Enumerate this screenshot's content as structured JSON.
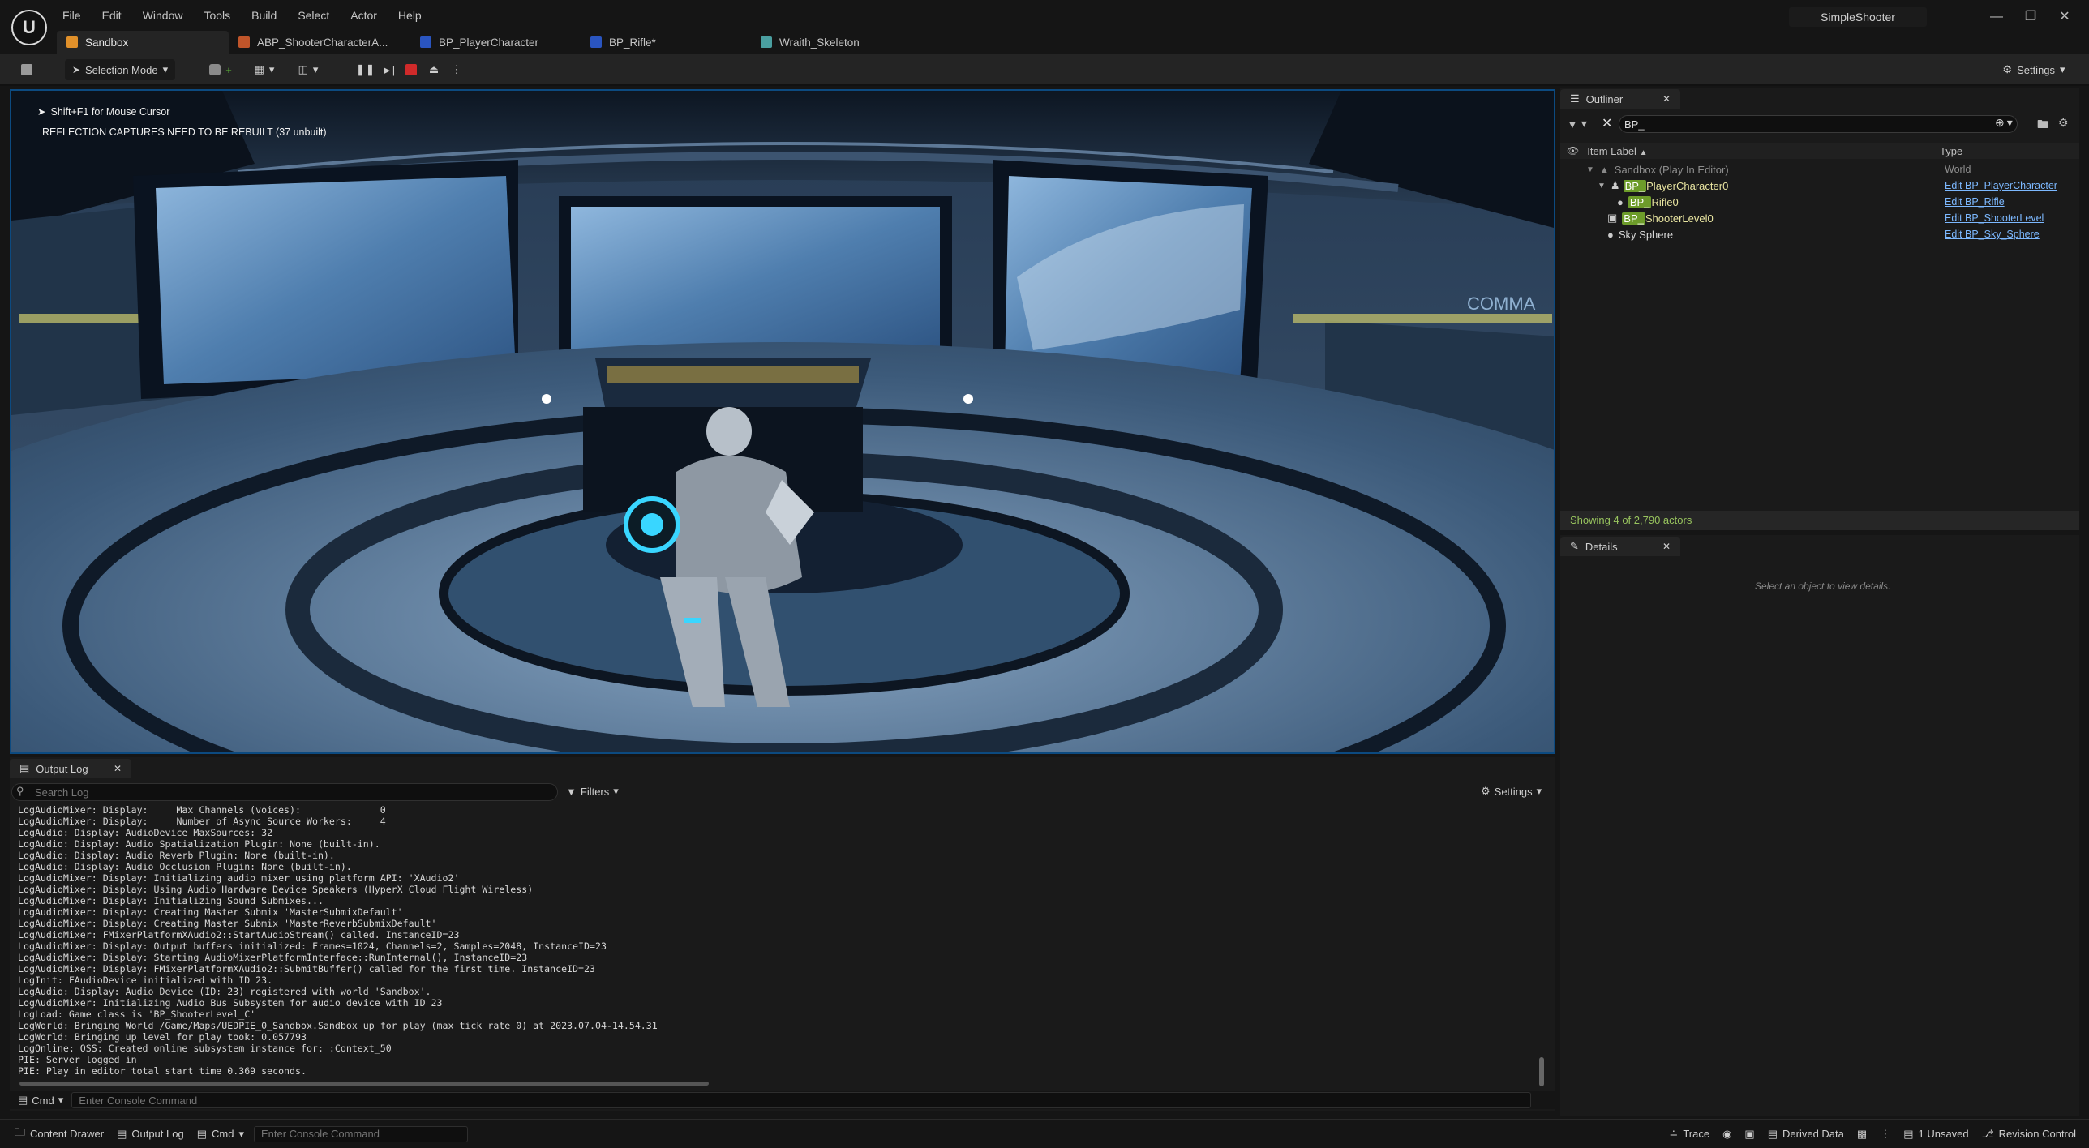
{
  "app": {
    "project_name": "SimpleShooter",
    "menu": [
      "File",
      "Edit",
      "Window",
      "Tools",
      "Build",
      "Select",
      "Actor",
      "Help"
    ]
  },
  "tabs": [
    {
      "label": "Sandbox",
      "icon": "level-icon",
      "active": true
    },
    {
      "label": "ABP_ShooterCharacterA...",
      "icon": "anim-blueprint-icon",
      "active": false
    },
    {
      "label": "BP_PlayerCharacter",
      "icon": "blueprint-icon",
      "active": false
    },
    {
      "label": "BP_Rifle*",
      "icon": "blueprint-icon",
      "active": false
    },
    {
      "label": "Wraith_Skeleton",
      "icon": "skeleton-icon",
      "active": false
    }
  ],
  "toolbar": {
    "selection_mode": "Selection Mode",
    "settings": "Settings"
  },
  "viewport": {
    "hint": "Shift+F1 for Mouse Cursor",
    "warning": "REFLECTION CAPTURES NEED TO BE REBUILT (37 unbuilt)",
    "sign_text": "COMMA"
  },
  "outliner": {
    "tab_label": "Outliner",
    "search_value": "BP_",
    "col_label": "Item Label",
    "col_type": "Type",
    "rows": [
      {
        "label": "Sandbox (Play In Editor)",
        "type": "World",
        "indent": 0
      },
      {
        "label_hl": "BP_",
        "label_rest": "PlayerCharacter0",
        "type": "Edit BP_PlayerCharacter",
        "indent": 1
      },
      {
        "label_hl": "BP_",
        "label_rest": "Rifle0",
        "type": "Edit BP_Rifle",
        "indent": 2
      },
      {
        "label_hl": "BP_",
        "label_rest": "ShooterLevel0",
        "type": "Edit BP_ShooterLevel",
        "indent": 1
      },
      {
        "label": "Sky Sphere",
        "type": "Edit BP_Sky_Sphere",
        "indent": 1
      }
    ],
    "actor_count": "Showing 4 of 2,790 actors"
  },
  "details": {
    "tab_label": "Details",
    "empty_message": "Select an object to view details."
  },
  "output_log": {
    "tab_label": "Output Log",
    "search_placeholder": "Search Log",
    "filters": "Filters",
    "settings": "Settings",
    "cmd": "Cmd",
    "console_placeholder": "Enter Console Command",
    "lines": [
      "LogAudioMixer: Display:     Max Channels (voices):              0",
      "LogAudioMixer: Display:     Number of Async Source Workers:     4",
      "LogAudio: Display: AudioDevice MaxSources: 32",
      "LogAudio: Display: Audio Spatialization Plugin: None (built-in).",
      "LogAudio: Display: Audio Reverb Plugin: None (built-in).",
      "LogAudio: Display: Audio Occlusion Plugin: None (built-in).",
      "LogAudioMixer: Display: Initializing audio mixer using platform API: 'XAudio2'",
      "LogAudioMixer: Display: Using Audio Hardware Device Speakers (HyperX Cloud Flight Wireless)",
      "LogAudioMixer: Display: Initializing Sound Submixes...",
      "LogAudioMixer: Display: Creating Master Submix 'MasterSubmixDefault'",
      "LogAudioMixer: Display: Creating Master Submix 'MasterReverbSubmixDefault'",
      "LogAudioMixer: FMixerPlatformXAudio2::StartAudioStream() called. InstanceID=23",
      "LogAudioMixer: Display: Output buffers initialized: Frames=1024, Channels=2, Samples=2048, InstanceID=23",
      "LogAudioMixer: Display: Starting AudioMixerPlatformInterface::RunInternal(), InstanceID=23",
      "LogAudioMixer: Display: FMixerPlatformXAudio2::SubmitBuffer() called for the first time. InstanceID=23",
      "LogInit: FAudioDevice initialized with ID 23.",
      "LogAudio: Display: Audio Device (ID: 23) registered with world 'Sandbox'.",
      "LogAudioMixer: Initializing Audio Bus Subsystem for audio device with ID 23",
      "LogLoad: Game class is 'BP_ShooterLevel_C'",
      "LogWorld: Bringing World /Game/Maps/UEDPIE_0_Sandbox.Sandbox up for play (max tick rate 0) at 2023.07.04-14.54.31",
      "LogWorld: Bringing up level for play took: 0.057793",
      "LogOnline: OSS: Created online subsystem instance for: :Context_50",
      "PIE: Server logged in",
      "PIE: Play in editor total start time 0.369 seconds."
    ]
  },
  "statusbar": {
    "content_drawer": "Content Drawer",
    "output_log": "Output Log",
    "cmd": "Cmd",
    "console_placeholder": "Enter Console Command",
    "trace": "Trace",
    "derived_data": "Derived Data",
    "unsaved": "1 Unsaved",
    "revision_control": "Revision Control"
  },
  "colors": {
    "accent_blue": "#0c4a80",
    "search_highlight": "#6d9c2a",
    "link": "#7cb8ff",
    "stop_red": "#d02a2a"
  }
}
